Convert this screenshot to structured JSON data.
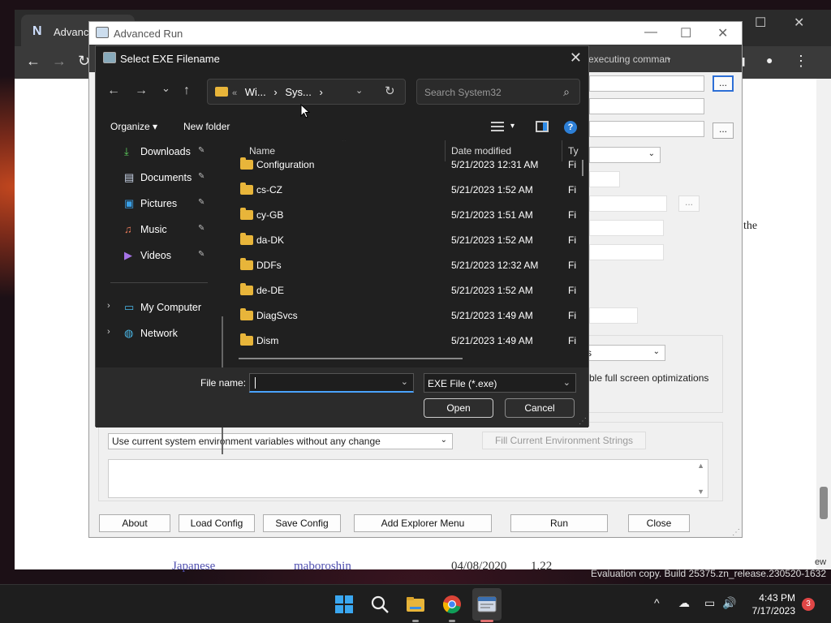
{
  "browser": {
    "tab_label": "Advance",
    "tab_logo": "N",
    "win_controls": [
      "—",
      "☐",
      "✕"
    ],
    "nav": [
      "←",
      "→",
      "↻"
    ],
    "toolbar_text": "executing comman",
    "right_text": "the",
    "right_text2": "ew",
    "bottom_row": [
      "Japanese",
      "maboroshin",
      "04/08/2020",
      "1.22"
    ],
    "eval_text": "Evaluation copy. Build 25375.zn_release.230520-1632"
  },
  "advanced_run": {
    "title": "Advanced Run",
    "win_controls": [
      "—",
      "☐",
      "✕"
    ],
    "dots_label": "...",
    "fullscreen_text": "ble full screen optimizations",
    "combo_s": "s",
    "env_option": "Use current system environment variables without any change",
    "fill_env_label": "Fill Current Environment Strings",
    "buttons": {
      "about": "About",
      "load_config": "Load Config",
      "save_config": "Save Config",
      "add_explorer": "Add Explorer Menu",
      "run": "Run",
      "close": "Close"
    }
  },
  "dialog": {
    "title": "Select EXE Filename",
    "close_glyph": "✕",
    "nav": {
      "back": "←",
      "forward": "→",
      "recent": "⌄",
      "up": "↑"
    },
    "address": {
      "overflow": "«",
      "crumbs": [
        "Wi...",
        "›",
        "Sys...",
        "›"
      ],
      "chevron": "⌄",
      "refresh": "↻"
    },
    "search_placeholder": "Search System32",
    "toolbar": {
      "organize": "Organize ▾",
      "new_folder": "New folder",
      "view_chev": "▾",
      "help": "?"
    },
    "sidebar": [
      {
        "label": "Downloads",
        "icon": "⤓",
        "pinned": true
      },
      {
        "label": "Documents",
        "icon": "▤",
        "pinned": true
      },
      {
        "label": "Pictures",
        "icon": "▣",
        "pinned": true
      },
      {
        "label": "Music",
        "icon": "♫",
        "pinned": true
      },
      {
        "label": "Videos",
        "icon": "▶",
        "pinned": true
      },
      {
        "label": "My Computer",
        "icon": "▭",
        "pinned": false
      },
      {
        "label": "Network",
        "icon": "◍",
        "pinned": false
      }
    ],
    "pin_glyph": "📌",
    "expand_glyph": "›",
    "columns": [
      "Name",
      "Date modified",
      "Ty"
    ],
    "sort_glyph": "⌃",
    "files": [
      {
        "name": "Configuration",
        "date": "5/21/2023 12:31 AM",
        "type": "Fi"
      },
      {
        "name": "cs-CZ",
        "date": "5/21/2023 1:52 AM",
        "type": "Fi"
      },
      {
        "name": "cy-GB",
        "date": "5/21/2023 1:51 AM",
        "type": "Fi"
      },
      {
        "name": "da-DK",
        "date": "5/21/2023 1:52 AM",
        "type": "Fi"
      },
      {
        "name": "DDFs",
        "date": "5/21/2023 12:32 AM",
        "type": "Fi"
      },
      {
        "name": "de-DE",
        "date": "5/21/2023 1:52 AM",
        "type": "Fi"
      },
      {
        "name": "DiagSvcs",
        "date": "5/21/2023 1:49 AM",
        "type": "Fi"
      },
      {
        "name": "Dism",
        "date": "5/21/2023 1:49 AM",
        "type": "Fi"
      }
    ],
    "file_name_label": "File name:",
    "file_name_value": "",
    "file_type": "EXE File (*.exe)",
    "dropdown_glyph": "⌄",
    "open_label": "Open",
    "cancel_label": "Cancel",
    "grip_glyph": "⋰"
  },
  "taskbar": {
    "tray": [
      "^",
      "☁",
      "▭",
      "🔊"
    ],
    "time": "4:43 PM",
    "date": "7/17/2023",
    "badge": "3"
  },
  "colors": {
    "accent": "#2d7fd6",
    "folder": "#e8b53a",
    "dialog_bg": "#202020"
  }
}
